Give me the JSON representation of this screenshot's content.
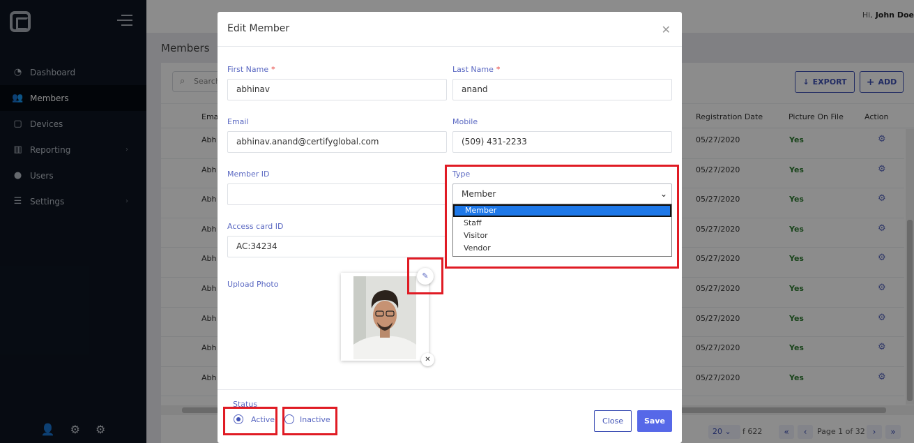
{
  "sidebar": {
    "items": [
      {
        "label": "Dashboard",
        "icon": "dashboard-icon"
      },
      {
        "label": "Members",
        "icon": "users-icon",
        "active": true
      },
      {
        "label": "Devices",
        "icon": "tablet-icon"
      },
      {
        "label": "Reporting",
        "icon": "chart-icon",
        "chevron": true
      },
      {
        "label": "Users",
        "icon": "user-icon"
      },
      {
        "label": "Settings",
        "icon": "sliders-icon",
        "chevron": true
      }
    ]
  },
  "topbar": {
    "greeting": "Hi,",
    "user": "John Doe"
  },
  "page": {
    "title": "Members",
    "search_placeholder": "Search",
    "export_label": "EXPORT",
    "add_label": "ADD",
    "columns": [
      "Email",
      "Registration Date",
      "Picture On File",
      "Action"
    ],
    "rows": [
      {
        "name": "Abh",
        "date": "05/27/2020",
        "picture": "Yes"
      },
      {
        "name": "Abh",
        "date": "05/27/2020",
        "picture": "Yes"
      },
      {
        "name": "Abh",
        "date": "05/27/2020",
        "picture": "Yes"
      },
      {
        "name": "Abh",
        "date": "05/27/2020",
        "picture": "Yes"
      },
      {
        "name": "Abh",
        "date": "05/27/2020",
        "picture": "Yes"
      },
      {
        "name": "Abh",
        "date": "05/27/2020",
        "picture": "Yes"
      },
      {
        "name": "Abh",
        "date": "05/27/2020",
        "picture": "Yes"
      },
      {
        "name": "Abh",
        "date": "05/27/2020",
        "picture": "Yes"
      },
      {
        "name": "Abh",
        "date": "05/27/2020",
        "picture": "Yes"
      }
    ],
    "pager": {
      "per_page": "20",
      "total": "f 622",
      "page_label": "Page 1 of 32"
    }
  },
  "modal": {
    "title": "Edit Member",
    "first_name_label": "First Name",
    "first_name": "abhinav",
    "last_name_label": "Last Name",
    "last_name": "anand",
    "email_label": "Email",
    "email": "abhinav.anand@certifyglobal.com",
    "mobile_label": "Mobile",
    "mobile": "(509) 431-2233",
    "member_id_label": "Member ID",
    "member_id": "",
    "type_label": "Type",
    "type_value": "Member",
    "type_options": [
      "Member",
      "Staff",
      "Visitor",
      "Vendor"
    ],
    "access_card_label": "Access card ID",
    "access_card": "AC:34234",
    "upload_photo_label": "Upload Photo",
    "status_label": "Status",
    "status_active": "Active",
    "status_inactive": "Inactive",
    "close_label": "Close",
    "save_label": "Save"
  },
  "colors": {
    "accent": "#3f51b5",
    "save": "#5668e8",
    "highlight": "#e01b24",
    "sidebar": "#0d1522"
  }
}
